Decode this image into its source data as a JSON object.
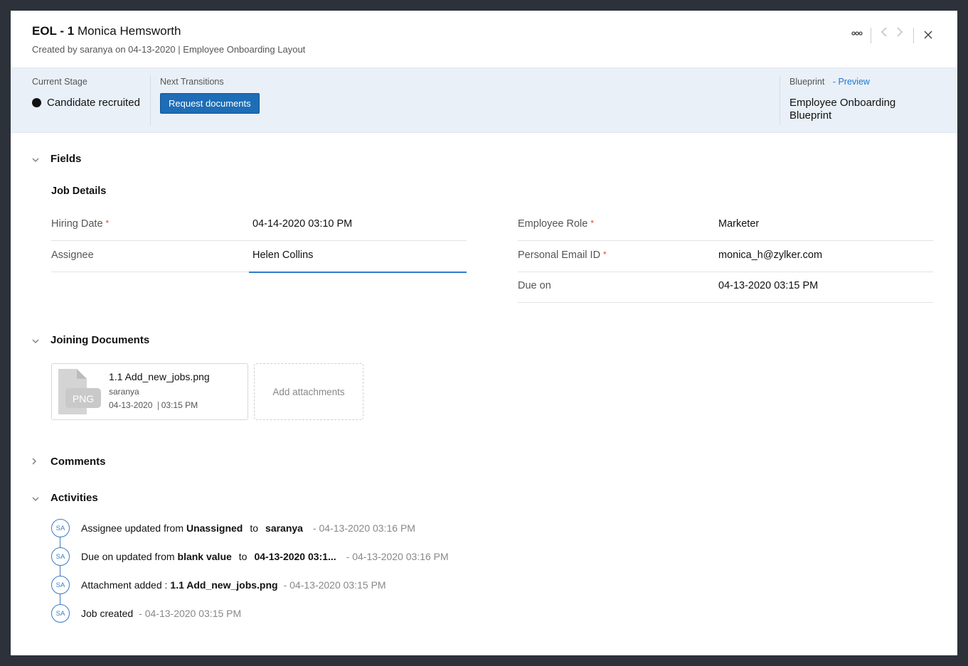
{
  "header": {
    "code": "EOL - 1",
    "name": "Monica Hemsworth",
    "created_by_prefix": "Created by",
    "created_by": "saranya",
    "created_on": "on 04-13-2020",
    "layout": "| Employee Onboarding Layout",
    "more_icon": "more-horizontal-icon",
    "prev_icon": "chevron-left-icon",
    "next_icon": "chevron-right-icon",
    "close_icon": "close-icon"
  },
  "stage": {
    "current_label": "Current Stage",
    "current_value": "Candidate recruited",
    "next_label": "Next Transitions",
    "next_button": "Request documents",
    "blueprint_label": "Blueprint",
    "preview_link": "- Preview",
    "blueprint_name": "Employee Onboarding Blueprint"
  },
  "sections": {
    "fields": "Fields",
    "job_details": "Job Details",
    "joining_documents": "Joining Documents",
    "comments": "Comments",
    "activities": "Activities"
  },
  "fields": {
    "hiring_date": {
      "label": "Hiring Date",
      "value": "04-14-2020 03:10 PM",
      "required": "*"
    },
    "assignee": {
      "label": "Assignee",
      "value": "Helen Collins"
    },
    "employee_role": {
      "label": "Employee Role",
      "value": "Marketer",
      "required": "*"
    },
    "personal_email": {
      "label": "Personal Email ID",
      "value": "monica_h@zylker.com",
      "required": "*"
    },
    "due_on": {
      "label": "Due on",
      "value": "04-13-2020 03:15 PM"
    }
  },
  "attachment": {
    "file_name": "1.1 Add_new_jobs.png",
    "type_badge": "PNG",
    "uploaded_by": "saranya",
    "date": "04-13-2020",
    "time": "03:15 PM",
    "add_label": "Add attachments"
  },
  "activities": [
    {
      "avatar": "SA",
      "text": "Assignee updated from",
      "from": "Unassigned",
      "to_word": "to",
      "to": "saranya",
      "time": "- 04-13-2020 03:16 PM"
    },
    {
      "avatar": "SA",
      "text": "Due on updated from",
      "from": "blank value",
      "to_word": "to",
      "to": "04-13-2020 03:1...",
      "time": "- 04-13-2020 03:16 PM"
    },
    {
      "avatar": "SA",
      "text": "Attachment added :",
      "detail": "1.1 Add_new_jobs.png",
      "time": "- 04-13-2020 03:15 PM"
    },
    {
      "avatar": "SA",
      "text": "Job created",
      "time": "- 04-13-2020 03:15 PM"
    }
  ],
  "colors": {
    "accent": "#1d6db7",
    "stage_bg": "#e9f0f8",
    "required": "#e0463b",
    "link": "#1d78d0"
  }
}
